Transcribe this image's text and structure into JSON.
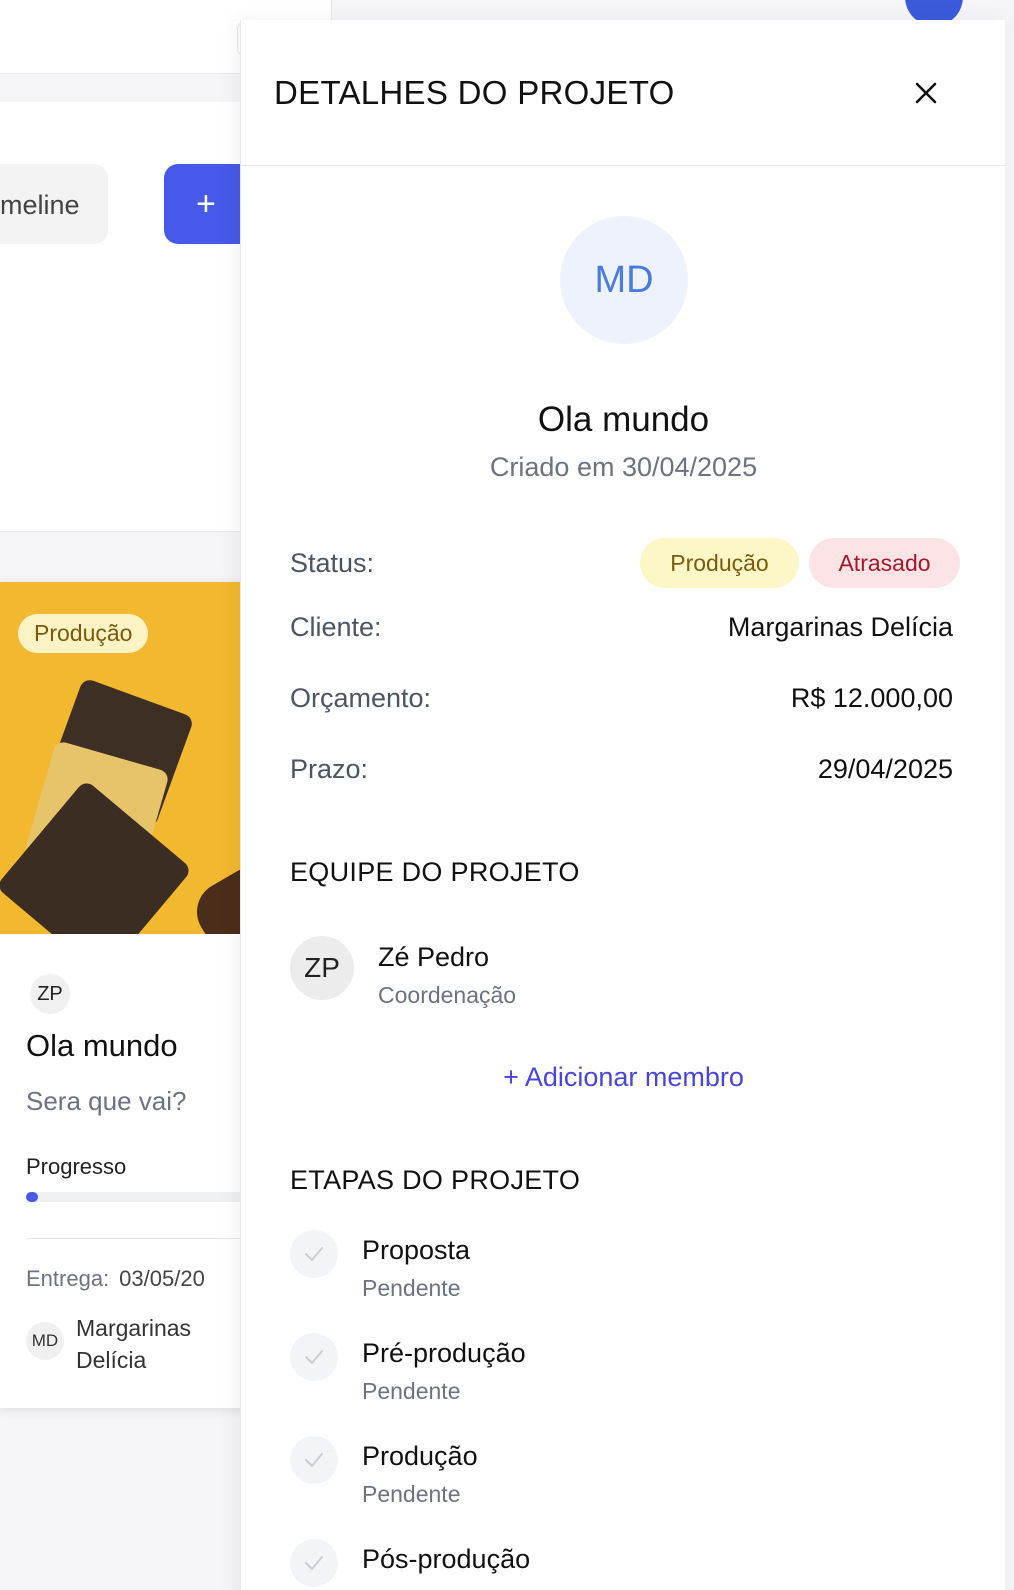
{
  "background": {
    "timeline_label": "meline",
    "add_label": "+",
    "card": {
      "badge": "Produção",
      "owner_initials": "ZP",
      "title": "Ola mundo",
      "subtitle": "Sera que vai?",
      "progress_label": "Progresso",
      "progress": 0.05,
      "delivery_label": "Entrega:",
      "delivery_date": "03/05/20",
      "client_initials": "MD",
      "client_name": "Margarinas Delícia"
    }
  },
  "drawer": {
    "title": "DETALHES DO PROJETO",
    "avatar_initials": "MD",
    "project_name": "Ola mundo",
    "created": "Criado em 30/04/2025",
    "status_label": "Status:",
    "status_badges": [
      "Produção",
      "Atrasado"
    ],
    "client_label": "Cliente:",
    "client_value": "Margarinas Delícia",
    "budget_label": "Orçamento:",
    "budget_value": "R$ 12.000,00",
    "deadline_label": "Prazo:",
    "deadline_value": "29/04/2025",
    "team_heading": "EQUIPE DO PROJETO",
    "members": [
      {
        "initials": "ZP",
        "name": "Zé Pedro",
        "role": "Coordenação"
      }
    ],
    "add_member": "+ Adicionar membro",
    "steps_heading": "ETAPAS DO PROJETO",
    "steps": [
      {
        "name": "Proposta",
        "status": "Pendente"
      },
      {
        "name": "Pré-produção",
        "status": "Pendente"
      },
      {
        "name": "Produção",
        "status": "Pendente"
      },
      {
        "name": "Pós-produção",
        "status": ""
      }
    ]
  },
  "colors": {
    "accent": "#4759e8",
    "link": "#4a45d8",
    "badge_production_bg": "#fdf6c7",
    "badge_late_bg": "#fce4e6"
  }
}
